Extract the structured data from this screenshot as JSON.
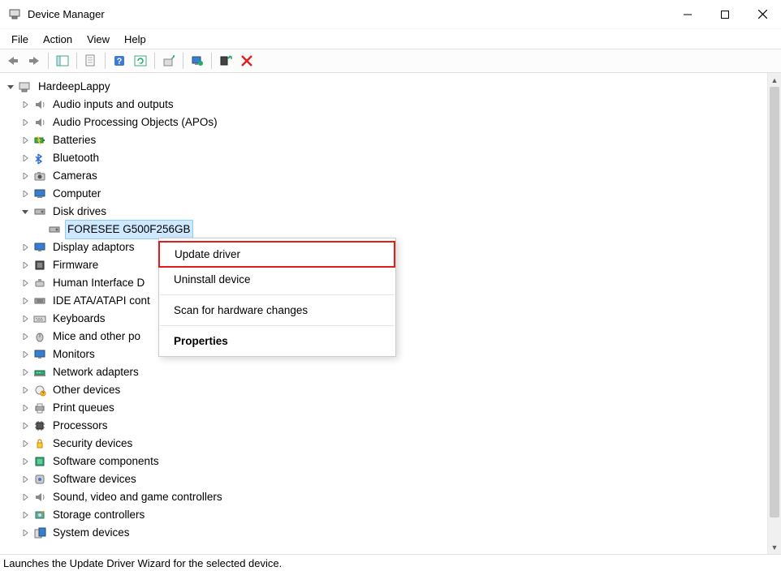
{
  "window": {
    "title": "Device Manager"
  },
  "menu": {
    "items": [
      "File",
      "Action",
      "View",
      "Help"
    ]
  },
  "toolbar_icons": [
    "back-arrow-icon",
    "forward-arrow-icon",
    "sep",
    "show-hide-tree-icon",
    "sep",
    "properties-icon",
    "sep",
    "help-icon",
    "refresh-icon",
    "sep",
    "update-driver-icon",
    "sep",
    "enable-device-icon",
    "sep",
    "uninstall-device-icon",
    "delete-icon"
  ],
  "tree": {
    "root": {
      "label": "HardeepLappy",
      "expanded": true,
      "icon": "computer-root"
    },
    "children": [
      {
        "label": "Audio inputs and outputs",
        "icon": "audio",
        "expanded": false
      },
      {
        "label": "Audio Processing Objects (APOs)",
        "icon": "audio",
        "expanded": false
      },
      {
        "label": "Batteries",
        "icon": "battery",
        "expanded": false
      },
      {
        "label": "Bluetooth",
        "icon": "bluetooth",
        "expanded": false
      },
      {
        "label": "Cameras",
        "icon": "camera",
        "expanded": false
      },
      {
        "label": "Computer",
        "icon": "computer",
        "expanded": false
      },
      {
        "label": "Disk drives",
        "icon": "disk",
        "expanded": true,
        "children": [
          {
            "label": "FORESEE G500F256GB",
            "icon": "disk",
            "selected": true
          }
        ]
      },
      {
        "label": "Display adaptors",
        "icon": "display",
        "expanded": false
      },
      {
        "label": "Firmware",
        "icon": "firmware",
        "expanded": false
      },
      {
        "label": "Human Interface Devices",
        "icon": "hid",
        "expanded": false,
        "truncated": "Human Interface D"
      },
      {
        "label": "IDE ATA/ATAPI controllers",
        "icon": "ide",
        "expanded": false,
        "truncated": "IDE ATA/ATAPI cont"
      },
      {
        "label": "Keyboards",
        "icon": "keyboard",
        "expanded": false
      },
      {
        "label": "Mice and other pointing devices",
        "icon": "mouse",
        "expanded": false,
        "truncated": "Mice and other po"
      },
      {
        "label": "Monitors",
        "icon": "monitor",
        "expanded": false
      },
      {
        "label": "Network adapters",
        "icon": "network",
        "expanded": false
      },
      {
        "label": "Other devices",
        "icon": "other",
        "expanded": false
      },
      {
        "label": "Print queues",
        "icon": "printer",
        "expanded": false
      },
      {
        "label": "Processors",
        "icon": "processor",
        "expanded": false
      },
      {
        "label": "Security devices",
        "icon": "security",
        "expanded": false
      },
      {
        "label": "Software components",
        "icon": "component",
        "expanded": false
      },
      {
        "label": "Software devices",
        "icon": "softdev",
        "expanded": false
      },
      {
        "label": "Sound, video and game controllers",
        "icon": "audio",
        "expanded": false
      },
      {
        "label": "Storage controllers",
        "icon": "storage",
        "expanded": false
      },
      {
        "label": "System devices",
        "icon": "system",
        "expanded": false,
        "truncated": "System devices"
      }
    ]
  },
  "context_menu": {
    "items": [
      {
        "label": "Update driver",
        "highlighted": true
      },
      {
        "label": "Uninstall device"
      },
      {
        "sep": true
      },
      {
        "label": "Scan for hardware changes"
      },
      {
        "sep": true
      },
      {
        "label": "Properties",
        "bold": true
      }
    ]
  },
  "statusbar": {
    "text": "Launches the Update Driver Wizard for the selected device."
  }
}
